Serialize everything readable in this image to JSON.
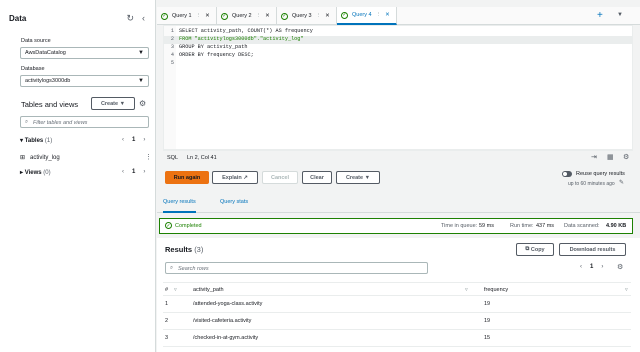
{
  "sidebar": {
    "title": "Data",
    "data_source_label": "Data source",
    "data_source_value": "AwsDataCatalog",
    "database_label": "Database",
    "database_value": "activitylogs3000db",
    "tables_views_title": "Tables and views",
    "create_label": "Create",
    "filter_placeholder": "Filter tables and views",
    "tables_label": "Tables",
    "tables_count": "(1)",
    "tables_page": "1",
    "table_item": "activity_log",
    "views_label": "Views",
    "views_count": "(0)",
    "views_page": "1"
  },
  "tabs": [
    {
      "label": "Query 1"
    },
    {
      "label": "Query 2"
    },
    {
      "label": "Query 3"
    },
    {
      "label": "Query 4"
    }
  ],
  "editor": {
    "lines": [
      {
        "num": "1",
        "code": "SELECT activity_path, COUNT(*) AS frequency"
      },
      {
        "num": "2",
        "code": "FROM \"activitylogs3000db\".\"activity_log\""
      },
      {
        "num": "3",
        "code": "GROUP BY activity_path"
      },
      {
        "num": "4",
        "code": "ORDER BY frequency DESC;"
      },
      {
        "num": "5",
        "code": ""
      }
    ]
  },
  "statusbar": {
    "lang": "SQL",
    "position": "Ln 2, Col 41"
  },
  "actions": {
    "run_again": "Run again",
    "explain": "Explain",
    "cancel": "Cancel",
    "clear": "Clear",
    "create": "Create",
    "reuse_label": "Reuse query results",
    "reuse_sub": "up to 60 minutes ago"
  },
  "result_tabs": {
    "query_results": "Query results",
    "query_stats": "Query stats"
  },
  "status": {
    "completed": "Completed",
    "time_in_queue_label": "Time in queue:",
    "time_in_queue": "59 ms",
    "run_time_label": "Run time:",
    "run_time": "437 ms",
    "data_scanned_label": "Data scanned:",
    "data_scanned": "4.90 KB"
  },
  "results": {
    "title": "Results",
    "count": "(3)",
    "copy": "Copy",
    "download": "Download results",
    "search_placeholder": "Search rows",
    "page": "1",
    "columns": [
      "#",
      "activity_path",
      "frequency"
    ],
    "rows": [
      {
        "n": "1",
        "path": "/attended-yoga-class.activity",
        "freq": "19"
      },
      {
        "n": "2",
        "path": "/visited-cafeteria.activity",
        "freq": "19"
      },
      {
        "n": "3",
        "path": "/checked-in-at-gym.activity",
        "freq": "15"
      }
    ]
  },
  "colors": {
    "accent": "#0073bb",
    "run_button": "#ec7211",
    "success": "#1d8102"
  }
}
